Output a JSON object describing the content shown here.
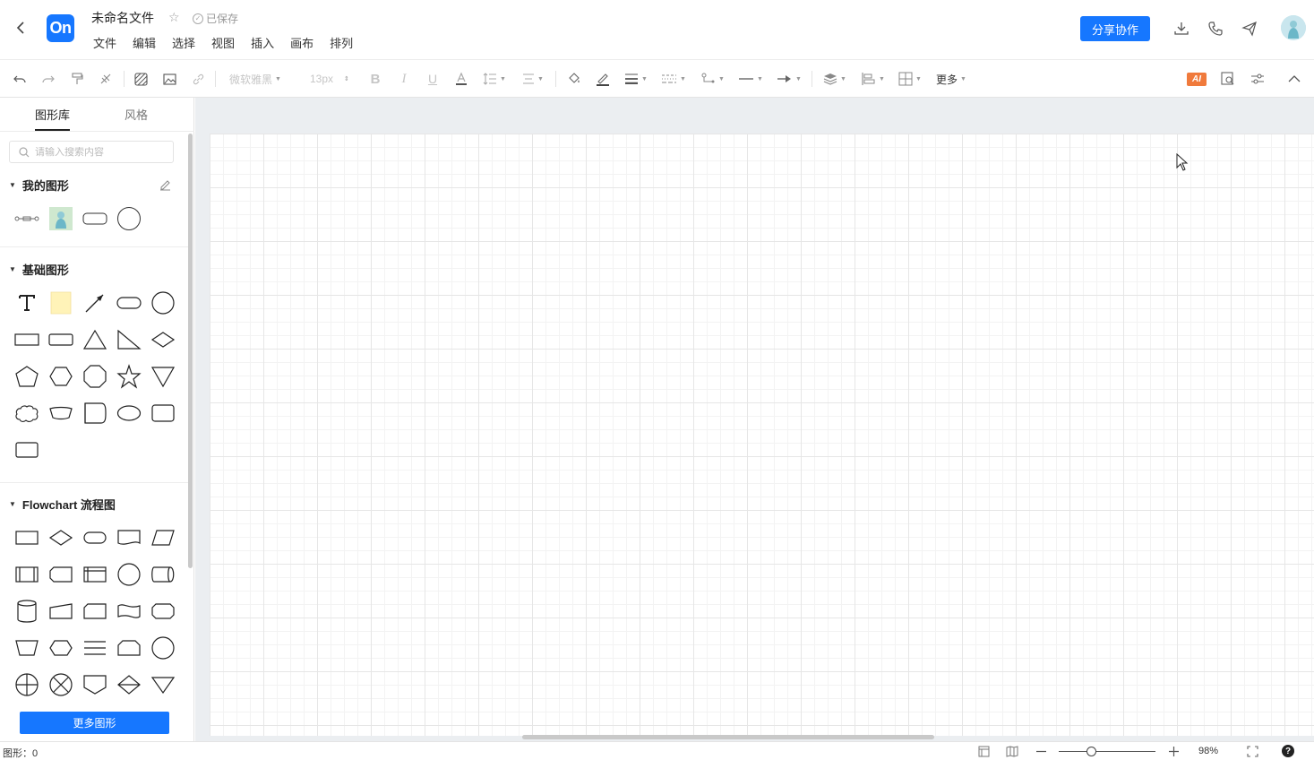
{
  "header": {
    "logo_text": "On",
    "file_name": "未命名文件",
    "saved_status": "已保存",
    "menu": [
      "文件",
      "编辑",
      "选择",
      "视图",
      "插入",
      "画布",
      "排列"
    ],
    "share_button": "分享协作"
  },
  "toolbar": {
    "font_family": "微软雅黑",
    "font_size": "13px",
    "more_label": "更多",
    "ai_label": "AI"
  },
  "sidebar": {
    "tabs": [
      "图形库",
      "风格"
    ],
    "active_tab": "图形库",
    "search_placeholder": "请输入搜索内容",
    "sections": {
      "my_shapes": "我的图形",
      "basic_shapes": "基础图形",
      "flowchart": "Flowchart 流程图"
    },
    "more_shapes_button": "更多图形"
  },
  "status": {
    "shape_count": "图形：0",
    "zoom": "98%",
    "help": "?"
  },
  "colors": {
    "accent": "#1677ff",
    "ai_badge": "#f07a3c",
    "note_fill": "#fff3b8",
    "canvas_bg": "#ebeef1"
  }
}
